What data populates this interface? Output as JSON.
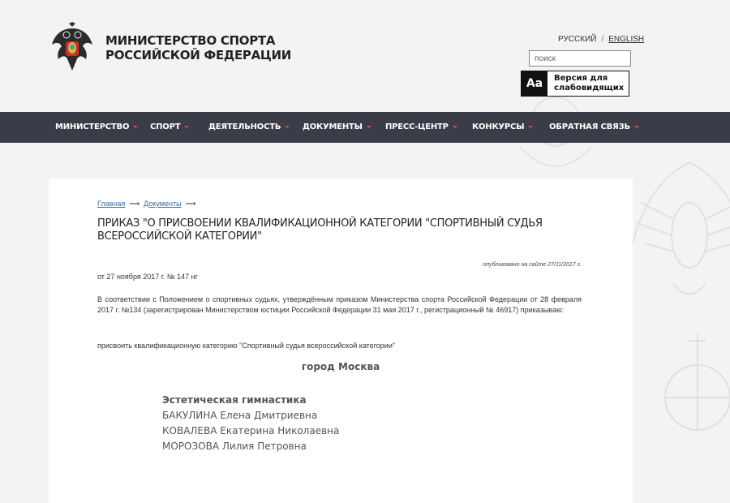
{
  "header": {
    "title_line1": "Министерство спорта",
    "title_line2": "Российской Федерации",
    "lang_ru": "РУССКИЙ",
    "lang_sep": "/",
    "lang_en": "ENGLISH",
    "search_placeholder": "поиск",
    "a11y_icon": "Aa",
    "a11y_label_line1": "Версия для",
    "a11y_label_line2": "слабовидящих"
  },
  "nav": {
    "items": [
      "Министерство",
      "Спорт",
      "Деятельность",
      "Документы",
      "Пресс-центр",
      "Конкурсы",
      "Обратная связь"
    ]
  },
  "breadcrumb": {
    "home": "Главная",
    "documents": "Документы"
  },
  "document": {
    "title": "ПРИКАЗ \"О ПРИСВОЕНИИ КВАЛИФИКАЦИОННОЙ КАТЕГОРИИ \"СПОРТИВНЫЙ СУДЬЯ ВСЕРОССИЙСКОЙ КАТЕГОРИИ\"",
    "published": "опубликовано на сайте 27/11/2017 г.",
    "date": "от 27 ноября 2017 г. № 147 нг",
    "paragraph": "В соответствии с Положением о спортивных судьях, утверждённым приказом Министерства спорта Российской Федерации от 28 февраля 2017 г. №134 (зарегистрирован Министерством юстиции Российской Федерации 31 мая 2017 г., регистрационный № 46917) приказываю:",
    "decree": "присвоить квалификационную категорию \"Спортивный судья всероссийской категории\"",
    "city": "город Москва",
    "sport": "Эстетическая гимнастика",
    "persons": [
      "БАКУЛИНА Елена Дмитриевна",
      "КОВАЛЕВА Екатерина Николаевна",
      "МОРОЗОВА Лилия Петровна"
    ]
  },
  "colors": {
    "nav_bg": "#3a3c48",
    "caret": "#e04a3a",
    "link": "#3a6ea5",
    "page_bg": "#f3f3f3"
  }
}
